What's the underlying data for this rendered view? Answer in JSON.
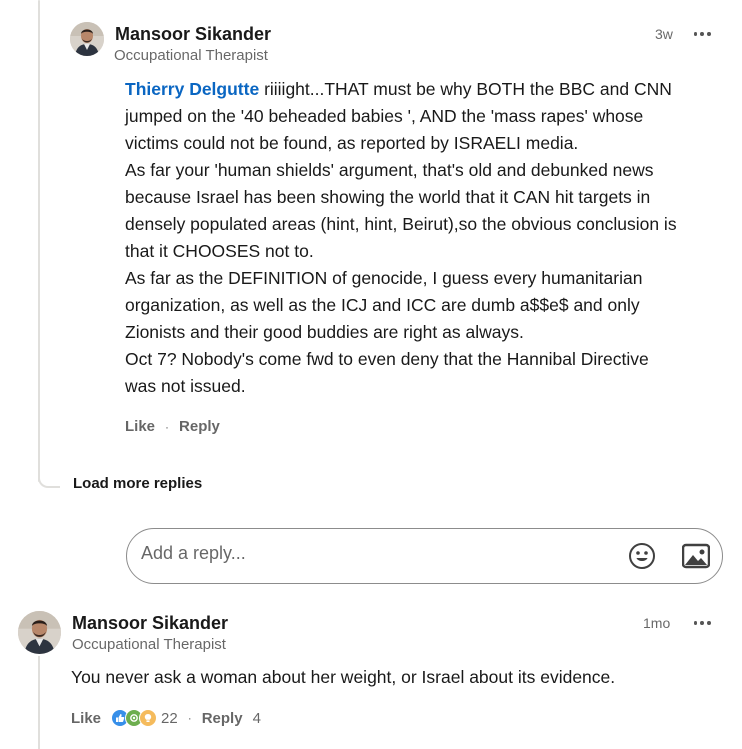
{
  "reply1": {
    "author": "Mansoor Sikander",
    "headline": "Occupational Therapist",
    "time": "3w",
    "mention": "Thierry Delgutte",
    "lines": [
      " riiiight...THAT must be why BOTH the BBC and CNN",
      "jumped on the '40 beheaded babies ', AND the 'mass rapes' whose",
      "victims could not be found, as reported by ISRAELI media.",
      "As far your 'human shields' argument, that's old and debunked news",
      "because Israel has been showing the world that it CAN hit targets in",
      "densely populated areas (hint, hint, Beirut),so the obvious conclusion is",
      "that it CHOOSES not to.",
      "As far as the DEFINITION of genocide, I guess every humanitarian",
      "organization, as well as the ICJ and ICC are dumb a$$e$ and only",
      "Zionists and their good buddies are right as always.",
      "Oct 7? Nobody's come fwd to even deny that the Hannibal Directive",
      "was not issued."
    ],
    "like_label": "Like",
    "reply_label": "Reply"
  },
  "load_more_label": "Load more replies",
  "reply_box": {
    "placeholder": "Add a reply...",
    "emoji_icon": "emoji-icon",
    "image_icon": "image-icon"
  },
  "comment2": {
    "author": "Mansoor Sikander",
    "headline": "Occupational Therapist",
    "time": "1mo",
    "text": "You never ask a woman about her weight, or Israel about its evidence.",
    "like_label": "Like",
    "reaction_count": "22",
    "reply_label": "Reply",
    "reply_count": "4",
    "reactions": [
      "like-reaction-icon",
      "celebrate-reaction-icon",
      "insightful-reaction-icon"
    ]
  },
  "colors": {
    "link": "#0a66c2",
    "like": "#378fe9",
    "celebrate": "#44712e",
    "insightful": "#f5bb5c"
  }
}
